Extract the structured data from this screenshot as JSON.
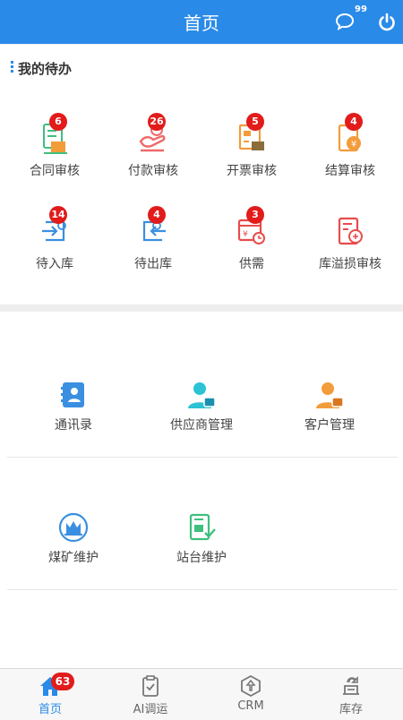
{
  "header": {
    "title": "首页",
    "message_count": "99"
  },
  "todo": {
    "title": "我的待办",
    "items": [
      {
        "label": "合同审核",
        "badge": "6",
        "icon": "contract-icon",
        "color": "#3fbf7f"
      },
      {
        "label": "付款审核",
        "badge": "26",
        "icon": "payment-icon",
        "color": "#ef6a6a"
      },
      {
        "label": "开票审核",
        "badge": "5",
        "icon": "invoice-icon",
        "color": "#f39c3a"
      },
      {
        "label": "结算审核",
        "badge": "4",
        "icon": "settlement-icon",
        "color": "#f39c3a"
      },
      {
        "label": "待入库",
        "badge": "14",
        "icon": "inbound-icon",
        "color": "#3a8fe0"
      },
      {
        "label": "待出库",
        "badge": "4",
        "icon": "outbound-icon",
        "color": "#3a8fe0"
      },
      {
        "label": "供需",
        "badge": "3",
        "icon": "supply-demand-icon",
        "color": "#e84c4c"
      },
      {
        "label": "库溢损审核",
        "badge": "",
        "icon": "inventory-loss-icon",
        "color": "#e84c4c"
      }
    ]
  },
  "modules": [
    {
      "label": "通讯录",
      "icon": "contacts-icon",
      "color": "#3a8fe0"
    },
    {
      "label": "供应商管理",
      "icon": "supplier-icon",
      "color": "#2cc3d5"
    },
    {
      "label": "客户管理",
      "icon": "customer-icon",
      "color": "#f39c3a"
    },
    {
      "label": "煤矿维护",
      "icon": "coal-mine-icon",
      "color": "#3a8fe0"
    },
    {
      "label": "站台维护",
      "icon": "station-icon",
      "color": "#3fbf7f"
    }
  ],
  "tabbar": [
    {
      "label": "首页",
      "badge": "63",
      "icon": "home-icon"
    },
    {
      "label": "AI调运",
      "badge": "",
      "icon": "dispatch-icon"
    },
    {
      "label": "CRM",
      "badge": "",
      "icon": "crm-icon"
    },
    {
      "label": "库存",
      "badge": "",
      "icon": "inventory-icon"
    }
  ],
  "colors": {
    "primary": "#2a8ae8",
    "badge": "#e21b1b"
  }
}
